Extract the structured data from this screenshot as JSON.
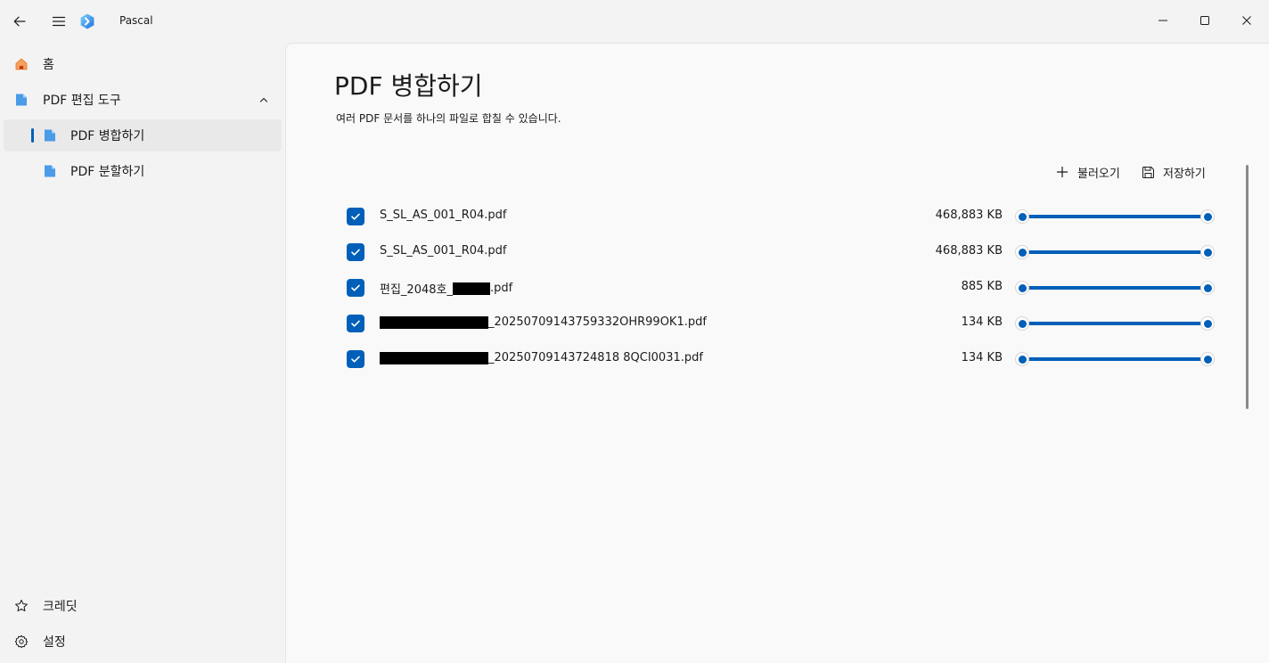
{
  "window": {
    "title": "Pascal"
  },
  "sidebar": {
    "home_label": "홈",
    "pdf_tools_label": "PDF 편집 도구",
    "merge_label": "PDF 병합하기",
    "split_label": "PDF 분할하기",
    "credit_label": "크레딧",
    "settings_label": "설정"
  },
  "main": {
    "title": "PDF 병합하기",
    "description": "여러 PDF 문서를 하나의 파일로 합칠 수 있습니다.",
    "import_label": "불러오기",
    "save_label": "저장하기",
    "files": [
      {
        "name": "S_SL_AS_001_R04.pdf",
        "size": "468,883 KB",
        "checked": true,
        "range_start": 0,
        "range_end": 1
      },
      {
        "name": "S_SL_AS_001_R04.pdf",
        "size": "468,883 KB",
        "checked": true,
        "range_start": 0,
        "range_end": 1
      },
      {
        "name_prefix": "편집_2048호_",
        "name_suffix": ".pdf",
        "size": "885 KB",
        "checked": true,
        "range_start": 0,
        "range_end": 1
      },
      {
        "name_suffix": "_20250709143759332OHR99OK1.pdf",
        "size": "134 KB",
        "checked": true,
        "range_start": 0,
        "range_end": 1
      },
      {
        "name_suffix": "_20250709143724818 8QCI0031.pdf",
        "size": "134 KB",
        "checked": true,
        "range_start": 0,
        "range_end": 1
      }
    ]
  },
  "colors": {
    "accent": "#005fb8",
    "home_icon": "#e8702a",
    "folder_icon": "#4a9be8"
  },
  "icons": {
    "back": "back-arrow-icon",
    "menu": "hamburger-menu-icon",
    "logo": "app-logo-icon",
    "home": "home-icon",
    "folder": "folder-icon",
    "chevron": "chevron-up-icon",
    "credit": "star-icon",
    "settings": "gear-icon",
    "import": "plus-icon",
    "save": "save-icon",
    "minimize": "minimize-icon",
    "maximize": "maximize-icon",
    "close": "close-icon"
  }
}
